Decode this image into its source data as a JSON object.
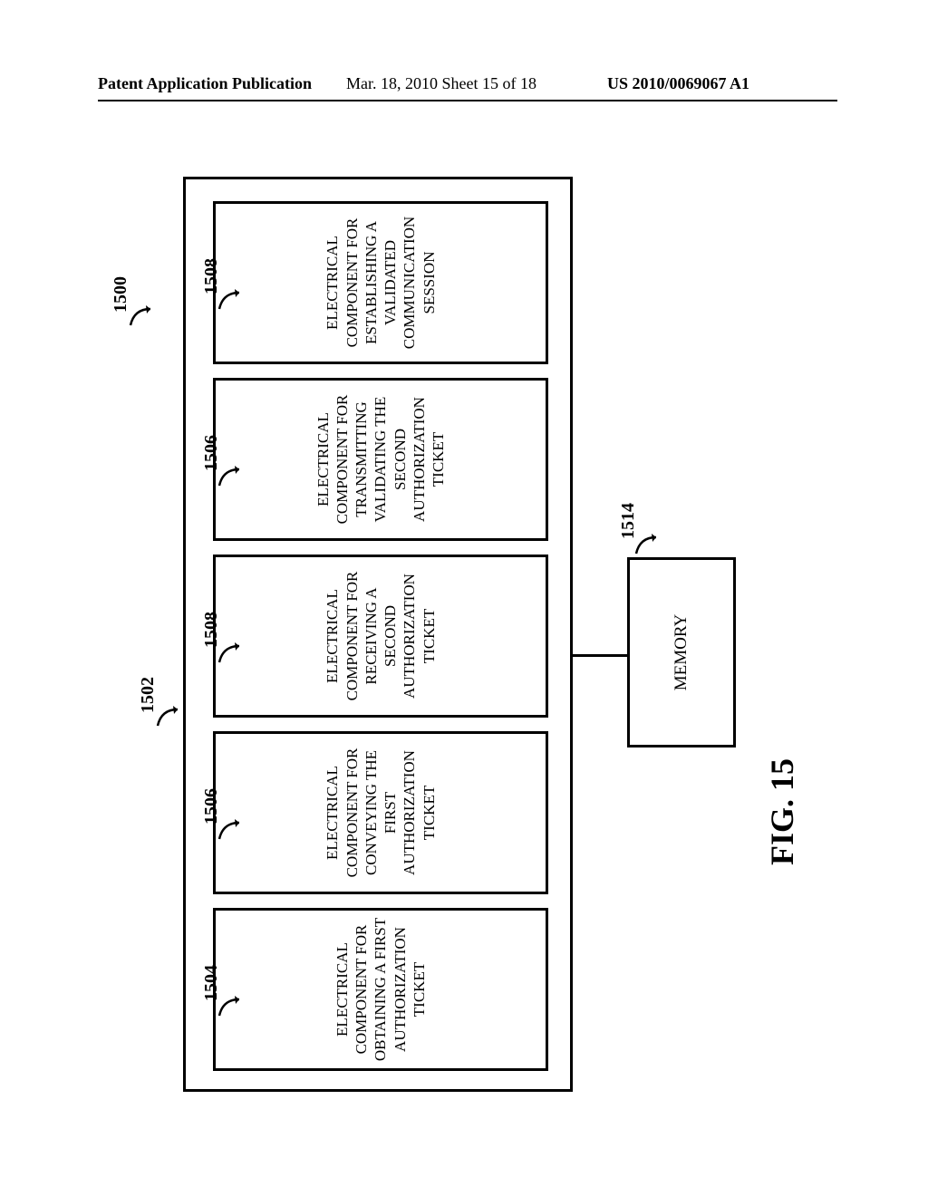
{
  "header": {
    "left": "Patent Application Publication",
    "mid": "Mar. 18, 2010  Sheet 15 of 18",
    "right": "US 2010/0069067 A1"
  },
  "figure": {
    "caption": "FIG. 15",
    "ref_main": "1500",
    "ref_outer": "1502",
    "memory_ref": "1514",
    "memory_label": "MEMORY",
    "blocks": [
      {
        "ref": "1504",
        "text": "ELECTRICAL COMPONENT FOR OBTAINING A FIRST AUTHORIZATION TICKET"
      },
      {
        "ref": "1506",
        "text": "ELECTRICAL COMPONENT FOR CONVEYING THE FIRST AUTHORIZATION TICKET"
      },
      {
        "ref": "1508",
        "text": "ELECTRICAL COMPONENT FOR RECEIVING A SECOND AUTHORIZATION TICKET"
      },
      {
        "ref": "1506",
        "text": "ELECTRICAL COMPONENT FOR TRANSMITTING VALIDATING THE SECOND AUTHORIZATION TICKET"
      },
      {
        "ref": "1508",
        "text": "ELECTRICAL COMPONENT FOR ESTABLISHING A VALIDATED COMMUNICATION SESSION"
      }
    ]
  }
}
